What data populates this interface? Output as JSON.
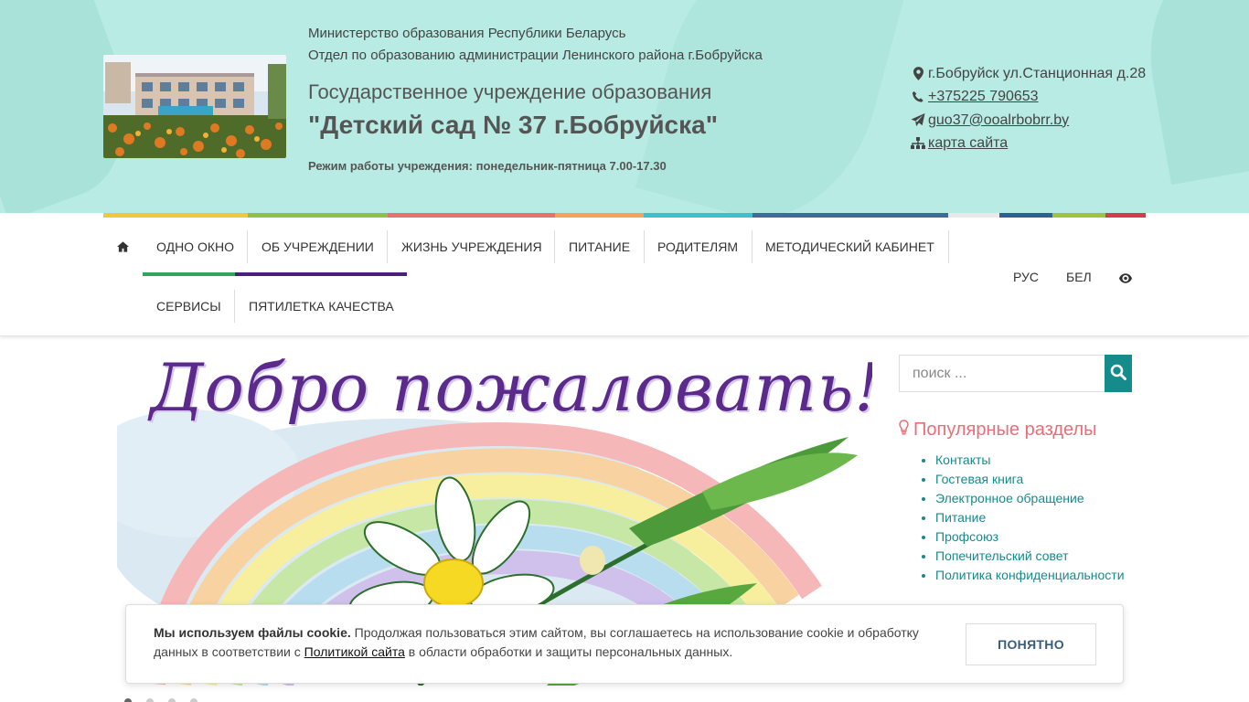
{
  "header": {
    "ministry": "Министерство образования Республики Беларусь",
    "department": "Отдел по образованию администрации Ленинского района г.Бобруйска",
    "institution_type": "Государственное учреждение образования",
    "institution_name": "\"Детский сад № 37 г.Бобруйска\"",
    "work_hours": "Режим работы учреждения: понедельник-пятница 7.00-17.30"
  },
  "contacts": {
    "address": "г.Бобруйск ул.Станционная д.28",
    "phone": "+375225 790653",
    "email": "guo37@ooalrbobrr.by",
    "sitemap": "карта сайта"
  },
  "nav": {
    "items": [
      "ОДНО ОКНО",
      "ОБ УЧРЕЖДЕНИИ",
      "ЖИЗНЬ УЧРЕЖДЕНИЯ",
      "ПИТАНИЕ",
      "РОДИТЕЛЯМ",
      "МЕТОДИЧЕСКИЙ КАБИНЕТ",
      "СЕРВИСЫ",
      "ПЯТИЛЕТКА КАЧЕСТВА"
    ],
    "languages": [
      "РУС",
      "БЕЛ"
    ]
  },
  "banner": {
    "welcome_text": "Добро пожаловать!"
  },
  "search": {
    "placeholder": "поиск ..."
  },
  "popular": {
    "title": "Популярные разделы",
    "items": [
      "Контакты",
      "Гостевая книга",
      "Электронное обращение",
      "Питание",
      "Профсоюз",
      "Попечительский совет",
      "Политика конфиденциальности"
    ]
  },
  "cookie": {
    "bold": "Мы используем файлы cookie.",
    "text_before": " Продолжая пользоваться этим сайтом, вы соглашаетесь на использование cookie и обработку данных в соответствии с ",
    "link": "Политикой сайта",
    "text_after": " в области обработки и защиты персональных данных.",
    "button": "ПОНЯТНО"
  },
  "colors": {
    "header_bg": "#b7ebe3",
    "accent_teal": "#158b8c",
    "popular_title": "#e86f78",
    "stripe": [
      "#f0c93a",
      "#8fc04b",
      "#ea6f73",
      "#f3a259",
      "#3fbdd1",
      "#2f5f95",
      "#3e6aa0",
      "#2f5f95",
      "#9fc340",
      "#d63a4e"
    ]
  },
  "icons": [
    "home-icon",
    "map-marker-icon",
    "phone-icon",
    "paper-plane-icon",
    "sitemap-icon",
    "eye-icon",
    "search-icon",
    "lightbulb-icon"
  ],
  "slider": {
    "slides": 4,
    "active": 1
  }
}
